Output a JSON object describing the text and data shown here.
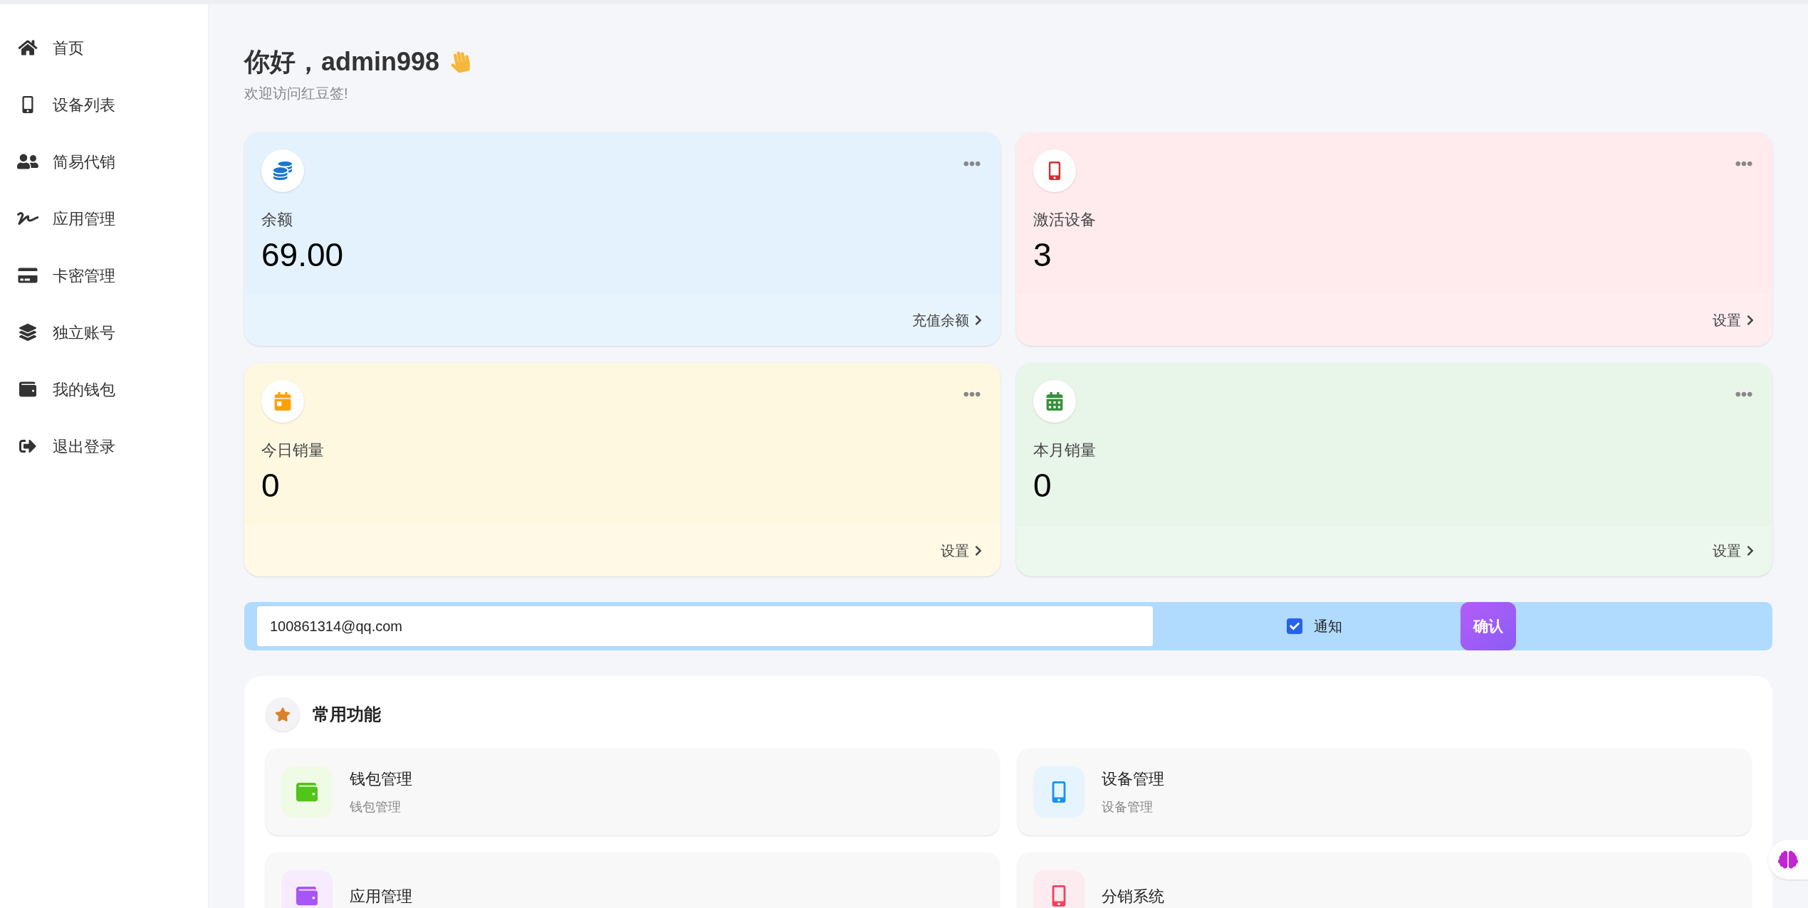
{
  "sidebar": {
    "items": [
      {
        "label": "首页"
      },
      {
        "label": "设备列表"
      },
      {
        "label": "简易代销"
      },
      {
        "label": "应用管理"
      },
      {
        "label": "卡密管理"
      },
      {
        "label": "独立账号"
      },
      {
        "label": "我的钱包"
      },
      {
        "label": "退出登录"
      }
    ]
  },
  "greeting": {
    "title": "你好，admin998",
    "subtitle": "欢迎访问红豆签!"
  },
  "stat_cards": [
    {
      "label": "余额",
      "value": "69.00",
      "link": "充值余额",
      "color": "#1976d2"
    },
    {
      "label": "激活设备",
      "value": "3",
      "link": "设置",
      "color": "#d32f2f"
    },
    {
      "label": "今日销量",
      "value": "0",
      "link": "设置",
      "color": "#ffa000"
    },
    {
      "label": "本月销量",
      "value": "0",
      "link": "设置",
      "color": "#388e3c"
    }
  ],
  "notify_bar": {
    "email": "100861314@qq.com",
    "checkbox": {
      "label": "通知",
      "checked": true
    },
    "button": "确认"
  },
  "common_functions": {
    "title": "常用功能",
    "items": [
      {
        "title": "钱包管理",
        "subtitle": "钱包管理"
      },
      {
        "title": "设备管理",
        "subtitle": "设备管理"
      },
      {
        "title": "应用管理"
      },
      {
        "title": "分销系统"
      }
    ]
  }
}
